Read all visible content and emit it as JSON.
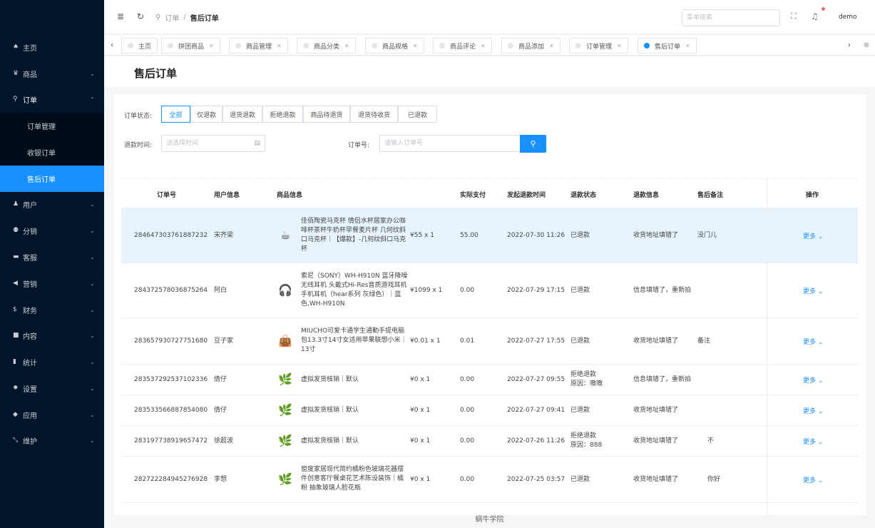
{
  "header": {
    "breadcrumb": [
      "订单",
      "售后订单"
    ],
    "menu_search_placeholder": "菜单搜索",
    "user": "demo"
  },
  "sidebar": {
    "items": [
      {
        "icon": "home-icon",
        "glyph": "♠",
        "label": "主页",
        "arrow": ""
      },
      {
        "icon": "goods-icon",
        "glyph": "♛",
        "label": "商品",
        "arrow": "⌄"
      },
      {
        "icon": "cart-icon",
        "glyph": "⚲",
        "label": "订单",
        "arrow": "⌃"
      },
      {
        "icon": "user-icon",
        "glyph": "♟",
        "label": "用户",
        "arrow": "⌄"
      },
      {
        "icon": "share-icon",
        "glyph": "⚉",
        "label": "分销",
        "arrow": "⌄"
      },
      {
        "icon": "service-icon",
        "glyph": "▬",
        "label": "客服",
        "arrow": "⌄"
      },
      {
        "icon": "marketing-icon",
        "glyph": "◀",
        "label": "营销",
        "arrow": "⌄"
      },
      {
        "icon": "finance-icon",
        "glyph": "$",
        "label": "财务",
        "arrow": "⌄"
      },
      {
        "icon": "content-icon",
        "glyph": "■",
        "label": "内容",
        "arrow": "⌄"
      },
      {
        "icon": "stats-icon",
        "glyph": "▮",
        "label": "统计",
        "arrow": "⌄"
      },
      {
        "icon": "settings-icon",
        "glyph": "✹",
        "label": "设置",
        "arrow": "⌄"
      },
      {
        "icon": "app-icon",
        "glyph": "◆",
        "label": "应用",
        "arrow": "⌄"
      },
      {
        "icon": "maintain-icon",
        "glyph": "⤡",
        "label": "维护",
        "arrow": "⌄"
      }
    ],
    "sub_items": [
      "订单管理",
      "收银订单",
      "售后订单"
    ]
  },
  "tabs": [
    "主页",
    "拼团商品",
    "商品管理",
    "商品分类",
    "商品规格",
    "商品评论",
    "商品添加",
    "订单管理",
    "售后订单"
  ],
  "page_title": "售后订单",
  "filters": {
    "status_label": "订单状态:",
    "status_options": [
      "全部",
      "仅退款",
      "退货退款",
      "拒绝退款",
      "商品待退货",
      "退货待收货",
      "已退款"
    ],
    "refund_time_label": "退款时间:",
    "refund_time_placeholder": "请选择时间",
    "order_no_label": "订单号:",
    "order_no_placeholder": "请输入订单号"
  },
  "table": {
    "columns": [
      "订单号",
      "用户信息",
      "商品信息",
      "实际支付",
      "发起退款时间",
      "退款状态",
      "退款信息",
      "售后备注",
      "操作"
    ],
    "rows": [
      {
        "order_no": "284647303761887232",
        "user": "宋齐梁",
        "thumb": "☕",
        "product": "佳佰陶瓷马克杯 情侣水杯居家办公咖啡杯茶杯牛奶杯早餐麦片杯 几何纹斜口马克杯｜【爆款】-几何纹斜口马克杯",
        "price_qty": "¥55 x 1",
        "paid": "55.00",
        "time": "2022-07-30 11:26",
        "status": "已退款",
        "status_reason": "",
        "refund_info": "收货地址填错了",
        "remark": "没门儿",
        "action": "更多 ⌄"
      },
      {
        "order_no": "284372578036875264",
        "user": "阿白",
        "thumb": "🎧",
        "product": "索尼（SONY）WH-H910N 蓝牙降噪无线耳机 头戴式Hi-Res音质游戏耳机 手机耳机（hear系列 灰绿色）｜蓝色,WH-H910N",
        "price_qty": "¥1099 x 1",
        "paid": "0.00",
        "time": "2022-07-29 17:15",
        "status": "已退款",
        "status_reason": "",
        "refund_info": "信息填错了，重新拍",
        "remark": "",
        "action": "更多 ⌄"
      },
      {
        "order_no": "283657930727751680",
        "user": "豆子家",
        "thumb": "👜",
        "product": "MIUCHO可爱卡通学生通勤手提电脑包13.3寸14寸女适用苹果联想小米｜13寸",
        "price_qty": "¥0.01 x 1",
        "paid": "0.01",
        "time": "2022-07-27 17:55",
        "status": "已退款",
        "status_reason": "",
        "refund_info": "收货地址填错了",
        "remark": "备注",
        "action": "更多 ⌄"
      },
      {
        "order_no": "283537292537102336",
        "user": "倩仔",
        "thumb": "🌿",
        "product": "虚拟发货核销｜默认",
        "price_qty": "¥0 x 1",
        "paid": "0.00",
        "time": "2022-07-27 09:55",
        "status": "拒绝退款",
        "status_reason": "原因：嗷嗷",
        "refund_info": "信息填错了，重新拍",
        "remark": "",
        "action": "更多 ⌄"
      },
      {
        "order_no": "283533566887854080",
        "user": "倩仔",
        "thumb": "🌿",
        "product": "虚拟发货核销｜默认",
        "price_qty": "¥0 x 1",
        "paid": "0.00",
        "time": "2022-07-27 09:41",
        "status": "已退款",
        "status_reason": "",
        "refund_info": "收货地址填错了",
        "remark": "",
        "action": "更多 ⌄"
      },
      {
        "order_no": "283197738919657472",
        "user": "徐超波",
        "thumb": "🌿",
        "product": "虚拟发货核销｜默认",
        "price_qty": "¥0 x 1",
        "paid": "0.00",
        "time": "2022-07-26 11:26",
        "status": "拒绝退款",
        "status_reason": "原因：888",
        "refund_info": "收货地址填错了",
        "remark": "不",
        "action": "更多 ⌄"
      },
      {
        "order_no": "282722284945276928",
        "user": "李想",
        "thumb": "🌿",
        "product": "窗度家居现代简约橘粉色玻璃花器摆件创意客厅餐桌花艺术陈设装饰｜橘粉 抽象玻璃人脸花瓶",
        "price_qty": "¥0 x 1",
        "paid": "0.00",
        "time": "2022-07-25 03:57",
        "status": "已退款",
        "status_reason": "",
        "refund_info": "收货地址填错了",
        "remark": "你好",
        "action": "更多 ⌄"
      }
    ]
  },
  "footer": "蜗牛学院",
  "colors": {
    "primary": "#1890ff",
    "sidebar_bg": "#001529",
    "highlight_row": "#e8f4fd"
  }
}
